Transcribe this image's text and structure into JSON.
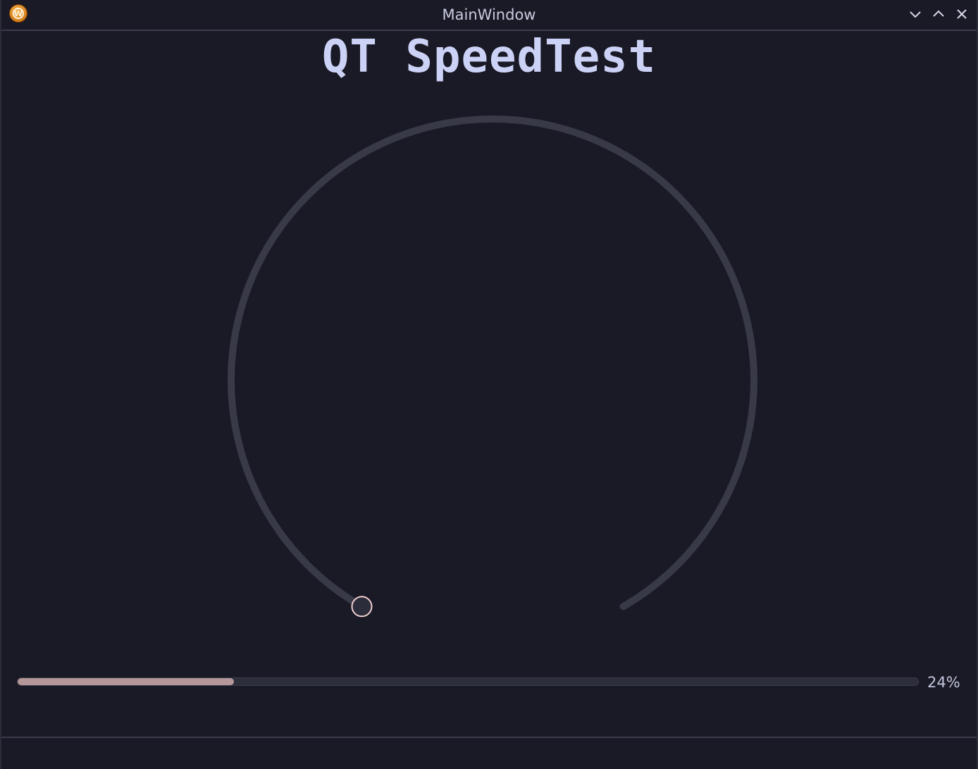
{
  "window": {
    "title": "MainWindow",
    "app_icon": "wesnoth-app-icon",
    "app_icon_glyph": "W",
    "buttons": {
      "minimize": "chevron-down-icon",
      "maximize": "chevron-up-icon",
      "close": "close-icon"
    }
  },
  "main": {
    "heading": "QT SpeedTest",
    "gauge": {
      "value": 0,
      "track_color": "#383a48",
      "handle_fill": "#2b2d3b",
      "handle_stroke": "#f1cfcf"
    },
    "progress": {
      "value": 24,
      "text": "24%",
      "fill_color": "#b69799"
    }
  },
  "colors": {
    "background": "#191a25",
    "title_text": "#c9cbe0",
    "heading_text": "#ccd2f5"
  }
}
